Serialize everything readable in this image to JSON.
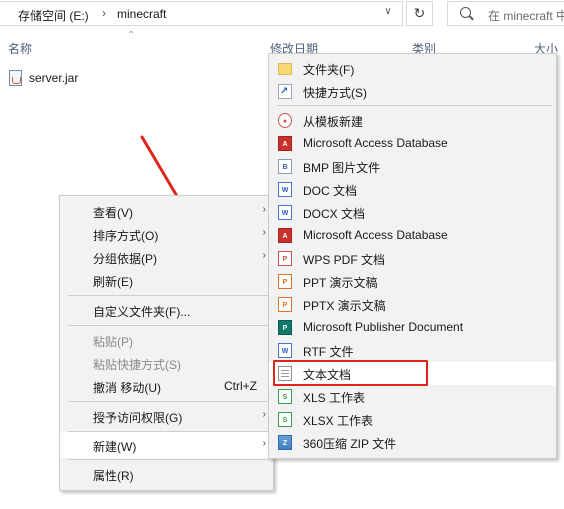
{
  "address": {
    "drive": "存储空间 (E:)",
    "folder": "minecraft",
    "separator": "›",
    "dropdown_icon": "chevron-down-icon",
    "refresh_icon": "refresh-icon"
  },
  "search": {
    "placeholder": "在 minecraft 中"
  },
  "columns": {
    "name": "名称",
    "modified": "修改日期",
    "type": "类别",
    "size": "大小"
  },
  "files": [
    {
      "name": "server.jar",
      "icon": "java-file-icon"
    }
  ],
  "context_menu": {
    "items": [
      {
        "label": "查看(V)",
        "submenu": true
      },
      {
        "label": "排序方式(O)",
        "submenu": true
      },
      {
        "label": "分组依据(P)",
        "submenu": true
      },
      {
        "label": "刷新(E)"
      },
      {
        "label": "自定义文件夹(F)..."
      },
      {
        "label": "粘贴(P)",
        "disabled": true
      },
      {
        "label": "粘贴快捷方式(S)",
        "disabled": true
      },
      {
        "label": "撤消 移动(U)",
        "shortcut": "Ctrl+Z"
      },
      {
        "label": "授予访问权限(G)",
        "submenu": true
      },
      {
        "label": "新建(W)",
        "submenu": true,
        "highlighted": true
      },
      {
        "label": "属性(R)"
      }
    ],
    "arrow": "›"
  },
  "new_submenu": {
    "items": [
      {
        "label": "文件夹(F)",
        "icon": "folder-icon"
      },
      {
        "label": "快捷方式(S)",
        "icon": "shortcut-icon"
      },
      {
        "label": "从模板新建",
        "icon": "template-icon"
      },
      {
        "label": "Microsoft Access Database",
        "icon": "access-icon"
      },
      {
        "label": "BMP 图片文件",
        "icon": "bmp-icon"
      },
      {
        "label": "DOC 文档",
        "icon": "doc-icon"
      },
      {
        "label": "DOCX 文档",
        "icon": "docx-icon"
      },
      {
        "label": "Microsoft Access Database",
        "icon": "access-icon"
      },
      {
        "label": "WPS PDF 文档",
        "icon": "pdf-icon"
      },
      {
        "label": "PPT 演示文稿",
        "icon": "ppt-icon"
      },
      {
        "label": "PPTX 演示文稿",
        "icon": "pptx-icon"
      },
      {
        "label": "Microsoft Publisher Document",
        "icon": "publisher-icon"
      },
      {
        "label": "RTF 文件",
        "icon": "rtf-icon"
      },
      {
        "label": "文本文档",
        "icon": "text-document-icon",
        "highlighted": true
      },
      {
        "label": "XLS 工作表",
        "icon": "xls-icon"
      },
      {
        "label": "XLSX 工作表",
        "icon": "xlsx-icon"
      },
      {
        "label": "360压缩 ZIP 文件",
        "icon": "zip-icon"
      }
    ]
  },
  "annotation": {
    "color": "#e0241b"
  }
}
